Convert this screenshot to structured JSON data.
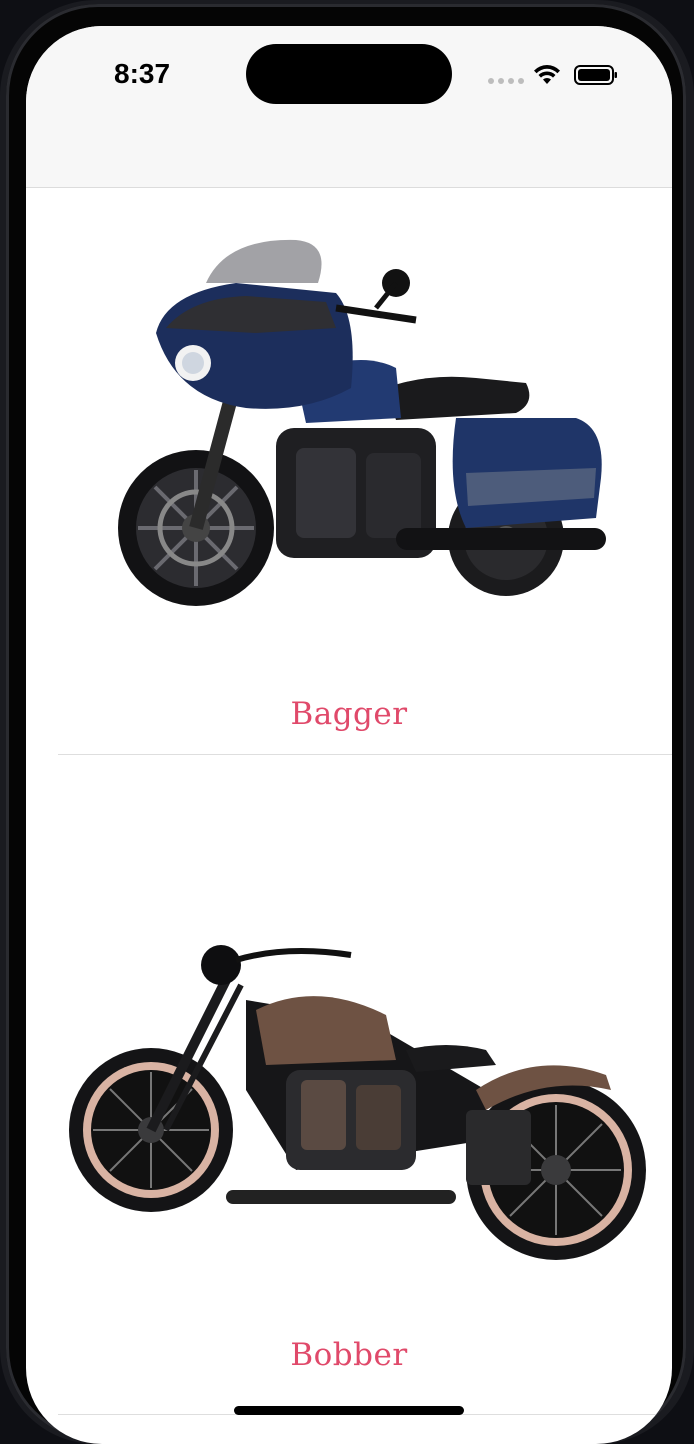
{
  "status_bar": {
    "time": "8:37"
  },
  "list": {
    "items": [
      {
        "label": "Bagger",
        "image_icon": "bagger-motorcycle-image"
      },
      {
        "label": "Bobber",
        "image_icon": "bobber-motorcycle-image"
      }
    ]
  },
  "colors": {
    "title_accent": "#e0496a",
    "nav_background": "#f7f7f7",
    "separator": "#dedede"
  }
}
